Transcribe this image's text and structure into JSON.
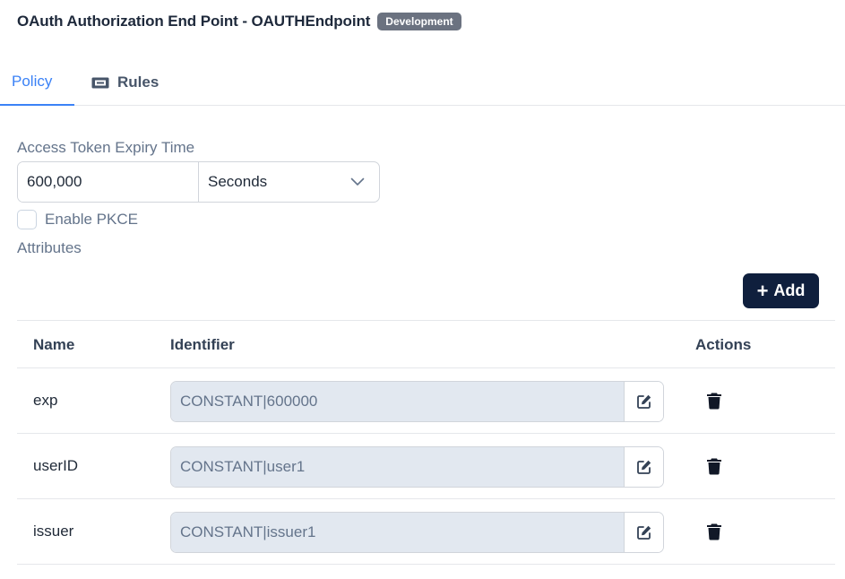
{
  "header": {
    "title": "OAuth Authorization End Point - OAUTHEndpoint",
    "badge": "Development"
  },
  "tabs": [
    {
      "label": "Policy",
      "active": true
    },
    {
      "label": "Rules",
      "icon": "ticket-icon",
      "active": false
    }
  ],
  "policy": {
    "expiry_label": "Access Token Expiry Time",
    "expiry_value": "600,000",
    "expiry_unit": "Seconds",
    "pkce_label": "Enable PKCE",
    "pkce_checked": false,
    "attributes_label": "Attributes",
    "add_label": "Add"
  },
  "table": {
    "columns": [
      "Name",
      "Identifier",
      "Actions"
    ],
    "rows": [
      {
        "name": "exp",
        "identifier": "CONSTANT|600000"
      },
      {
        "name": "userID",
        "identifier": "CONSTANT|user1"
      },
      {
        "name": "issuer",
        "identifier": "CONSTANT|issuer1"
      }
    ]
  },
  "colors": {
    "accent": "#3b82f6",
    "primary_button": "#0f1f3d",
    "badge": "#6b7280",
    "readonly_field": "#e2e8f0"
  }
}
